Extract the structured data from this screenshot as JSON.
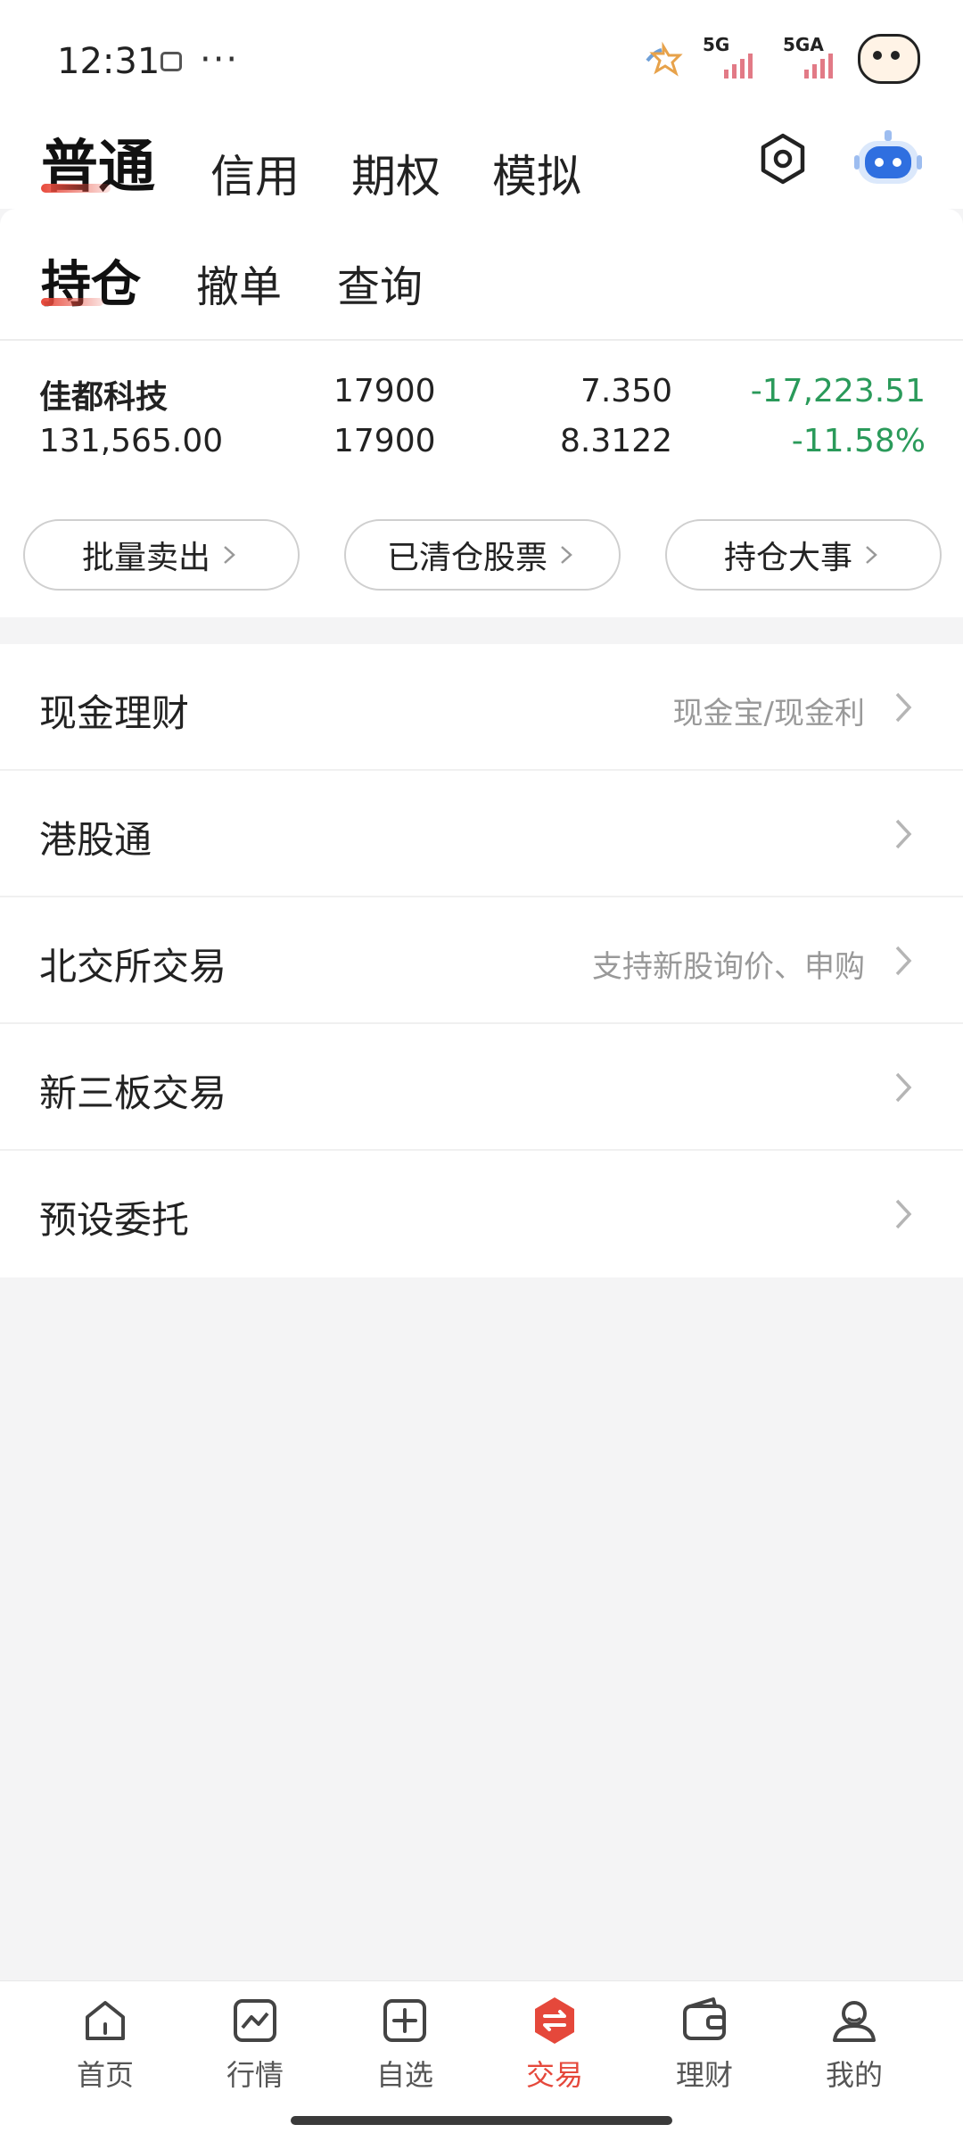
{
  "status_bar": {
    "time": "12:31",
    "more": "···",
    "signal_1": "5G",
    "signal_2": "5GA"
  },
  "account_tabs": [
    "普通",
    "信用",
    "期权",
    "模拟"
  ],
  "account_active": "普通",
  "sub_tabs": [
    "持仓",
    "撤单",
    "查询"
  ],
  "sub_active": "持仓",
  "position": {
    "name": "佳都科技",
    "market_value": "131,565.00",
    "holding_qty": "17900",
    "available_qty": "17900",
    "current_price": "7.350",
    "cost_price": "8.3122",
    "profit_loss": "-17,223.51",
    "profit_loss_pct": "-11.58%"
  },
  "actions": [
    "批量卖出",
    "已清仓股票",
    "持仓大事"
  ],
  "menu": [
    {
      "title": "现金理财",
      "hint": "现金宝/现金利"
    },
    {
      "title": "港股通",
      "hint": ""
    },
    {
      "title": "北交所交易",
      "hint": "支持新股询价、申购"
    },
    {
      "title": "新三板交易",
      "hint": ""
    },
    {
      "title": "预设委托",
      "hint": ""
    }
  ],
  "bottom_nav": [
    {
      "label": "首页",
      "icon": "home-icon"
    },
    {
      "label": "行情",
      "icon": "chart-icon"
    },
    {
      "label": "自选",
      "icon": "add-square-icon"
    },
    {
      "label": "交易",
      "icon": "trade-icon"
    },
    {
      "label": "理财",
      "icon": "wallet-icon"
    },
    {
      "label": "我的",
      "icon": "user-icon"
    }
  ],
  "colors": {
    "accent": "#e5483b",
    "loss_green": "#2a9a5a",
    "hint_gray": "#999999"
  }
}
